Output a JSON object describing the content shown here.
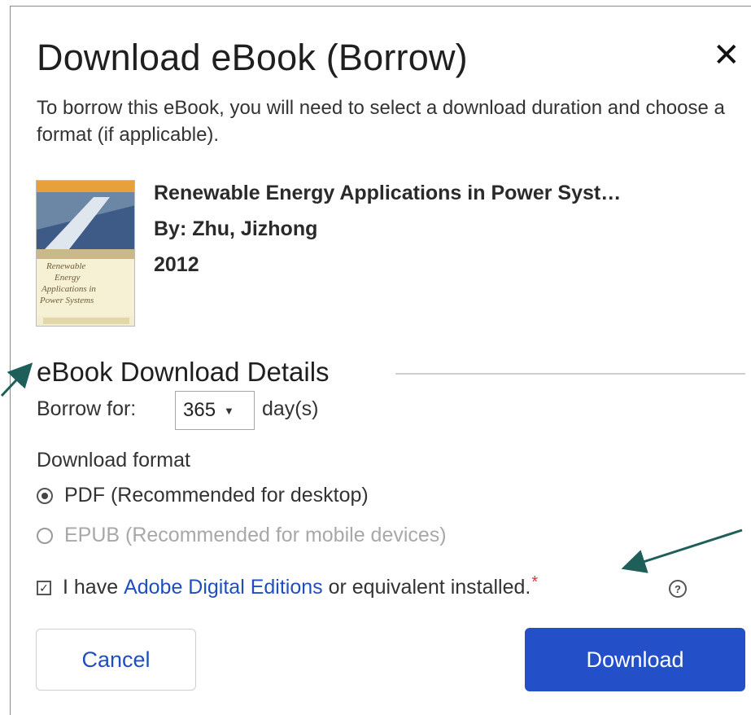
{
  "dialog": {
    "title": "Download eBook (Borrow)",
    "close_glyph": "✕",
    "intro": "To borrow this eBook, you will need to select a download duration and choose a format (if applicable)."
  },
  "book": {
    "title": "Renewable Energy Applications in Power Syst…",
    "author": "By: Zhu, Jizhong",
    "year": "2012",
    "cover_text": [
      "Renewable",
      "Energy",
      "Applications in",
      "Power Systems"
    ]
  },
  "details": {
    "heading": "eBook Download Details",
    "borrow_label": "Borrow for:",
    "borrow_value": "365",
    "borrow_unit": "day(s)",
    "format_label": "Download format",
    "formats": [
      {
        "label": "PDF (Recommended for desktop)",
        "selected": true,
        "enabled": true
      },
      {
        "label": "EPUB (Recommended for mobile devices)",
        "selected": false,
        "enabled": false
      }
    ],
    "ack_prefix": "I have ",
    "ack_link": "Adobe Digital Editions",
    "ack_suffix": " or equivalent installed.",
    "required_mark": "*",
    "help_glyph": "?"
  },
  "actions": {
    "cancel_label": "Cancel",
    "download_label": "Download"
  },
  "colors": {
    "accent": "#2350c9",
    "link": "#1f4fbf",
    "required": "#d23a3a",
    "annotation_arrow": "#1e5f59"
  }
}
